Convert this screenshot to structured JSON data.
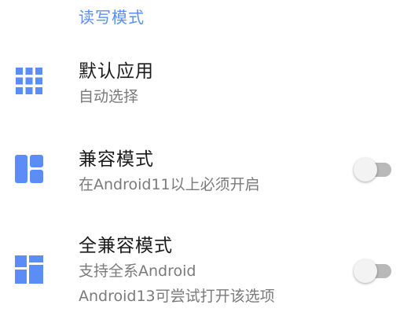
{
  "section": {
    "header": "读写模式"
  },
  "colors": {
    "accent": "#5c8df6",
    "switch_track_off": "#b9b9b9",
    "switch_thumb_off": "#f3f3f3"
  },
  "items": [
    {
      "title": "默认应用",
      "summary": "自动选择",
      "icon": "apps-grid-icon"
    },
    {
      "title": "兼容模式",
      "summary": "在Android11以上必须开启",
      "icon": "dashboard-layout-icon",
      "switch": {
        "checked": false
      }
    },
    {
      "title": "全兼容模式",
      "summary": "支持全系Android",
      "summary2": "Android13可尝试打开该选项",
      "icon": "quilt-layout-icon",
      "switch": {
        "checked": false
      }
    }
  ]
}
